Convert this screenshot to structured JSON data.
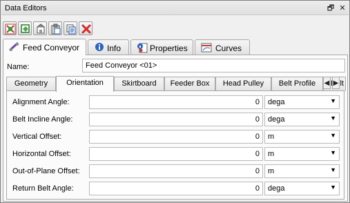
{
  "window": {
    "title": "Data Editors",
    "restore_glyph": "🗗",
    "close_glyph": "✕"
  },
  "toolbar": {
    "buttons": [
      "create-icon",
      "copy-object-icon",
      "import-icon",
      "paste-icon",
      "duplicate-icon",
      "delete-icon"
    ]
  },
  "main_tabs": [
    {
      "label": "Feed Conveyor",
      "icon": "conveyor-icon",
      "active": true
    },
    {
      "label": "Info",
      "icon": "info-icon",
      "active": false
    },
    {
      "label": "Properties",
      "icon": "properties-icon",
      "active": false
    },
    {
      "label": "Curves",
      "icon": "curves-icon",
      "active": false
    }
  ],
  "name": {
    "label": "Name:",
    "value": "Feed Conveyor <01>"
  },
  "sub_tabs": [
    {
      "label": "Geometry",
      "active": false
    },
    {
      "label": "Orientation",
      "active": true
    },
    {
      "label": "Skirtboard",
      "active": false
    },
    {
      "label": "Feeder Box",
      "active": false
    },
    {
      "label": "Head Pulley",
      "active": false
    },
    {
      "label": "Belt Profile",
      "active": false
    },
    {
      "label": "Belt",
      "active": false
    }
  ],
  "sub_tab_scroll": {
    "left": "◀",
    "right": "▶"
  },
  "fields": [
    {
      "label": "Alignment Angle:",
      "value": "0",
      "unit": "dega"
    },
    {
      "label": "Belt Incline Angle:",
      "value": "0",
      "unit": "dega"
    },
    {
      "label": "Vertical Offset:",
      "value": "0",
      "unit": "m"
    },
    {
      "label": "Horizontal Offset:",
      "value": "0",
      "unit": "m"
    },
    {
      "label": "Out-of-Plane Offset:",
      "value": "0",
      "unit": "m"
    },
    {
      "label": "Return Belt Angle:",
      "value": "0",
      "unit": "dega"
    }
  ]
}
